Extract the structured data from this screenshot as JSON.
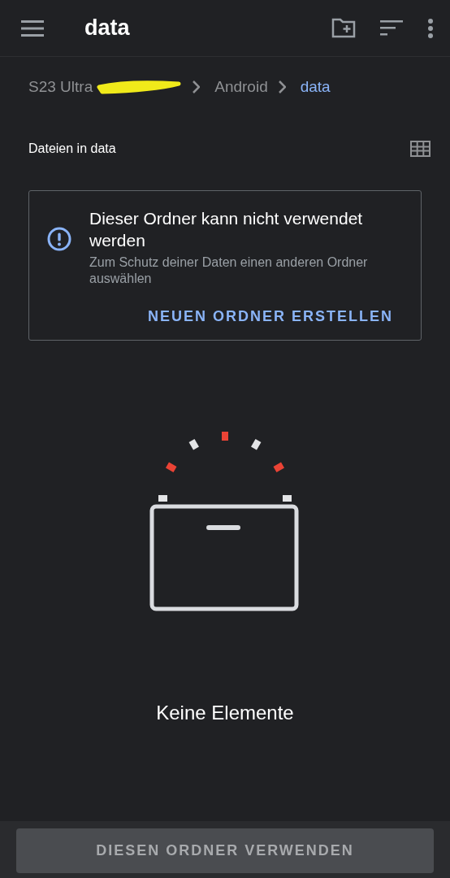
{
  "toolbar": {
    "title": "data"
  },
  "breadcrumbs": [
    {
      "label": "S23 Ultra",
      "redacted": true,
      "selected": false
    },
    {
      "label": "Android",
      "redacted": false,
      "selected": false
    },
    {
      "label": "data",
      "redacted": false,
      "selected": true
    }
  ],
  "section": {
    "title": "Dateien in data"
  },
  "warning": {
    "title": "Dieser Ordner kann nicht verwendet werden",
    "message": "Zum Schutz deiner Daten einen anderen Ordner auswählen",
    "action": "NEUEN ORDNER ERSTELLEN"
  },
  "empty_state": {
    "text": "Keine Elemente"
  },
  "bottom_button": {
    "label": "DIESEN ORDNER VERWENDEN",
    "disabled": true
  }
}
